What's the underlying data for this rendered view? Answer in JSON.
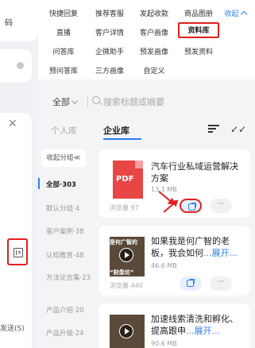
{
  "left": {
    "top_text": "码",
    "close_label": "✕",
    "bottom_text": "发送(S)"
  },
  "quick_menu": {
    "row1": [
      "快捷回复",
      "推荐客服",
      "发起收款",
      "商品图册"
    ],
    "collapse": "收起",
    "row2": [
      "直播",
      "客户详情",
      "客户画像",
      "资料库"
    ],
    "row3": [
      "问答库",
      "企微助手",
      "预发画像",
      "预发资料"
    ],
    "row4": [
      "预问答库",
      "三方画像",
      "自定义"
    ]
  },
  "search": {
    "scope": "全部",
    "placeholder": "搜索标题或摘要"
  },
  "tabs": {
    "personal": "个人库",
    "enterprise": "企业库"
  },
  "groups": {
    "collapse_label": "收起分组≪",
    "items": [
      "全部·303",
      "默认分组·4",
      "客户案例·38",
      "认知教育·48",
      "方法论合集·23",
      "产品介绍·20",
      "产品升级·24"
    ]
  },
  "cards": [
    {
      "type_label": "PDF",
      "title": "汽车行业私域运营解决方案",
      "size": "13.1 MB",
      "views": "浏览量 97",
      "more": "···"
    },
    {
      "thumb_top": "是何广智的",
      "thumb_bottom": "“财盘坊”",
      "title_a": "如果我是何广智的老板，我会如何",
      "title_more": "...展开...",
      "size": "46.6 MB",
      "views": "浏览量 440",
      "more": "···"
    },
    {
      "title_a": "加速线索清洗和孵化、提高跟申",
      "title_more": "...展开...",
      "size": "90.6 MB"
    }
  ],
  "colors": {
    "accent": "#2e7ff0",
    "highlight": "#e02020"
  }
}
